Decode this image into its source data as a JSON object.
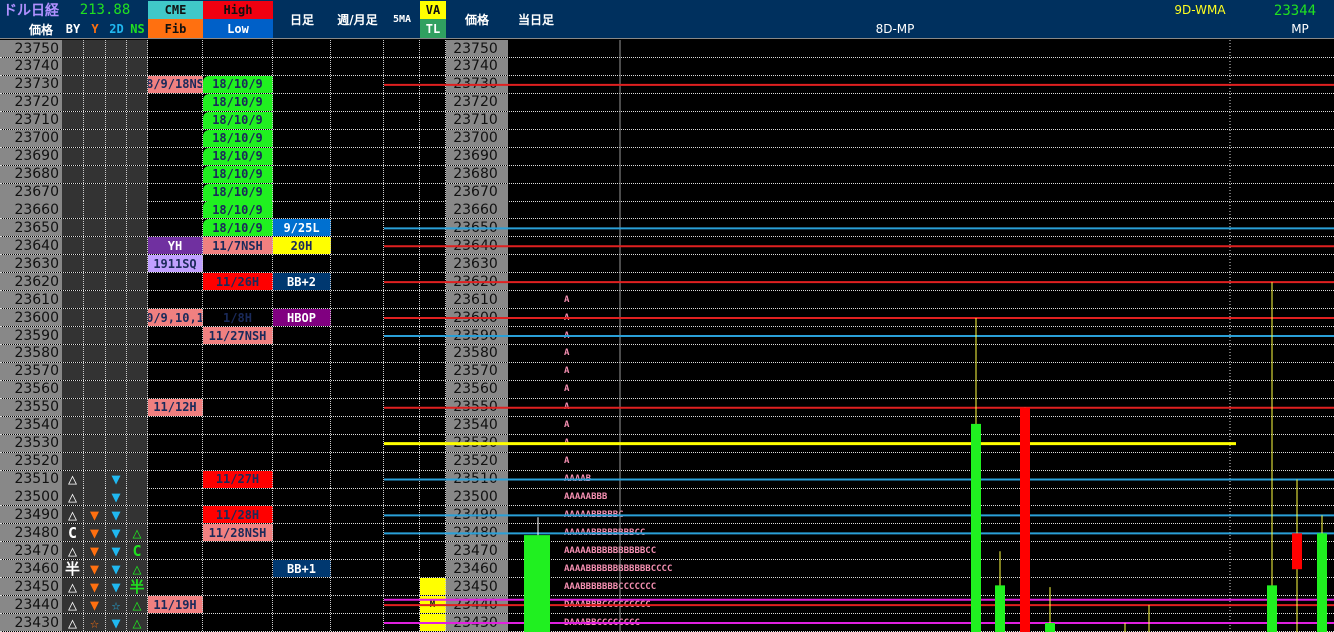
{
  "header": {
    "title": "ドル日経",
    "price_label": "価格",
    "usdjpy": "213.88",
    "by": "BY",
    "y": "Y",
    "d2": "2D",
    "ns": "NS",
    "cme": "CME",
    "fib": "Fib",
    "high": "High",
    "low": "Low",
    "daily": "日足",
    "weekly": "週/月足",
    "ma5": "5MA",
    "va": "VA",
    "tl": "TL",
    "price2": "価格",
    "today": "当日足",
    "mp8": "8D-MP",
    "wma_label": "9D-WMA",
    "wma_value": "23344",
    "mp": "MP"
  },
  "colors": {
    "pink": "#f08080",
    "green": "#20f020",
    "red": "#ff0000",
    "purple": "#7030a0",
    "lavender": "#c0a0ff",
    "blue": "#0070d0",
    "navy": "#003870",
    "yellow": "#ffff00",
    "hbop": "#800080",
    "by": "#ffffff",
    "y": "#ff7010",
    "d2": "#20b8f0",
    "ns": "#20e020"
  },
  "rows": [
    {
      "p": "23750"
    },
    {
      "p": "23740"
    },
    {
      "p": "23730",
      "cme": [
        "8/9/18NS",
        "pink"
      ],
      "hl": [
        "18/10/9",
        "green"
      ]
    },
    {
      "p": "23720",
      "hl": [
        "18/10/9",
        "green"
      ]
    },
    {
      "p": "23710",
      "hl": [
        "18/10/9",
        "green"
      ]
    },
    {
      "p": "23700",
      "hl": [
        "18/10/9",
        "green"
      ]
    },
    {
      "p": "23690",
      "hl": [
        "18/10/9",
        "green"
      ]
    },
    {
      "p": "23680",
      "hl": [
        "18/10/9",
        "green"
      ]
    },
    {
      "p": "23670",
      "hl": [
        "18/10/9",
        "green"
      ]
    },
    {
      "p": "23660",
      "hl": [
        "18/10/9",
        "green"
      ]
    },
    {
      "p": "23650",
      "hl": [
        "18/10/9",
        "green"
      ],
      "daily": [
        "9/25L",
        "blue"
      ]
    },
    {
      "p": "23640",
      "cme": [
        "YH",
        "purple"
      ],
      "hl": [
        "11/7NSH",
        "pink"
      ],
      "daily": [
        "20H",
        "yellow"
      ]
    },
    {
      "p": "23630",
      "cme": [
        "1911SQ",
        "lavender"
      ]
    },
    {
      "p": "23620",
      "hl": [
        "11/26H",
        "red"
      ],
      "daily": [
        "BB+2",
        "navy"
      ]
    },
    {
      "p": "23610",
      "tpo": "A"
    },
    {
      "p": "23600",
      "cme": [
        "0/9,10,1",
        "pink"
      ],
      "hl": [
        "1/8H",
        ""
      ],
      "daily": [
        "HBOP",
        "hbop"
      ],
      "tpo": "A"
    },
    {
      "p": "23590",
      "hl": [
        "11/27NSH",
        "pink"
      ],
      "tpo": "A"
    },
    {
      "p": "23580",
      "tpo": "A"
    },
    {
      "p": "23570",
      "tpo": "A"
    },
    {
      "p": "23560",
      "tpo": "A"
    },
    {
      "p": "23550",
      "cme": [
        "11/12H",
        "pink"
      ],
      "tpo": "A"
    },
    {
      "p": "23540",
      "tpo": "A"
    },
    {
      "p": "23530",
      "tpo": "A"
    },
    {
      "p": "23520",
      "tpo": "A"
    },
    {
      "p": "23510",
      "by": "△",
      "d2": "▼",
      "hl": [
        "11/27H",
        "red"
      ],
      "tpo": "AAAAB"
    },
    {
      "p": "23500",
      "by": "△",
      "d2": "▼",
      "tpo": "AAAAABBB"
    },
    {
      "p": "23490",
      "by": "△",
      "y": "▼",
      "d2": "▼",
      "hl": [
        "11/28H",
        "red"
      ],
      "tpo": "AAAAABBBBBC"
    },
    {
      "p": "23480",
      "by": "C",
      "y": "▼",
      "d2": "▼",
      "ns": "△",
      "hl": [
        "11/28NSH",
        "pink"
      ],
      "tpo": "AAAAABBBBBBBBCC"
    },
    {
      "p": "23470",
      "by": "△",
      "y": "▼",
      "d2": "▼",
      "ns": "C",
      "tpo": "AAAAABBBBBBBBBBCC"
    },
    {
      "p": "23460",
      "by": "半",
      "y": "▼",
      "d2": "▼",
      "ns": "△",
      "daily": [
        "BB+1",
        "navy"
      ],
      "tpo": "AAAABBBBBBBBBBBBCCCC"
    },
    {
      "p": "23450",
      "by": "△",
      "y": "▼",
      "d2": "▼",
      "ns": "半",
      "tpo": "AAABBBBBBBCCCCCCC",
      "va": true
    },
    {
      "p": "23440",
      "by": "△",
      "y": "▼",
      "d2": "☆",
      "ns": "△",
      "cme": [
        "11/19H",
        "pink"
      ],
      "tpo": "DAAABBBCCCCCCCCC",
      "va": true,
      "va_mark": "M"
    },
    {
      "p": "23430",
      "by": "△",
      "y": "☆",
      "d2": "▼",
      "ns": "△",
      "tpo": "DAAABBCCCCCCCC",
      "va": true
    }
  ],
  "levels": [
    {
      "price": 23730,
      "color": "#e02020"
    },
    {
      "price": 23650,
      "color": "#2aa0d8"
    },
    {
      "price": 23640,
      "color": "#e02020"
    },
    {
      "price": 23620,
      "color": "#e02020"
    },
    {
      "price": 23600,
      "color": "#e02020"
    },
    {
      "price": 23590,
      "color": "#2aa0d8"
    },
    {
      "price": 23550,
      "color": "#e02020"
    },
    {
      "price": 23530,
      "color": "#ffff00",
      "partial": true
    },
    {
      "price": 23510,
      "color": "#2aa0d8"
    },
    {
      "price": 23490,
      "color": "#2aa0d8"
    },
    {
      "price": 23480,
      "color": "#2aa0d8"
    },
    {
      "price": 23443,
      "color": "#e020e0"
    },
    {
      "price": 23440,
      "color": "#e02020"
    },
    {
      "price": 23430,
      "color": "#e020e0"
    }
  ],
  "today_candle": {
    "open": 23400,
    "high": 23489,
    "low": 23400,
    "close": 23479
  },
  "candles": [
    {
      "open": 23400,
      "high": 23600,
      "low": 23400,
      "close": 23541
    },
    {
      "open": 23400,
      "high": 23470,
      "low": 23400,
      "close": 23451
    },
    {
      "open": 23550,
      "high": 23550,
      "low": 23400,
      "close": 23400
    },
    {
      "open": 23400,
      "high": 23450,
      "low": 23400,
      "close": 23430
    },
    {
      "open": 23400,
      "high": 23430,
      "low": 23400,
      "close": 23400
    },
    {
      "open": 23400,
      "high": 23440,
      "low": 23400,
      "close": 23400
    },
    {
      "open": 23400,
      "high": 23620,
      "low": 23400,
      "close": 23451
    },
    {
      "open": 23480,
      "high": 23510,
      "low": 23400,
      "close": 23460
    },
    {
      "open": 23400,
      "high": 23490,
      "low": 23400,
      "close": 23480
    }
  ]
}
